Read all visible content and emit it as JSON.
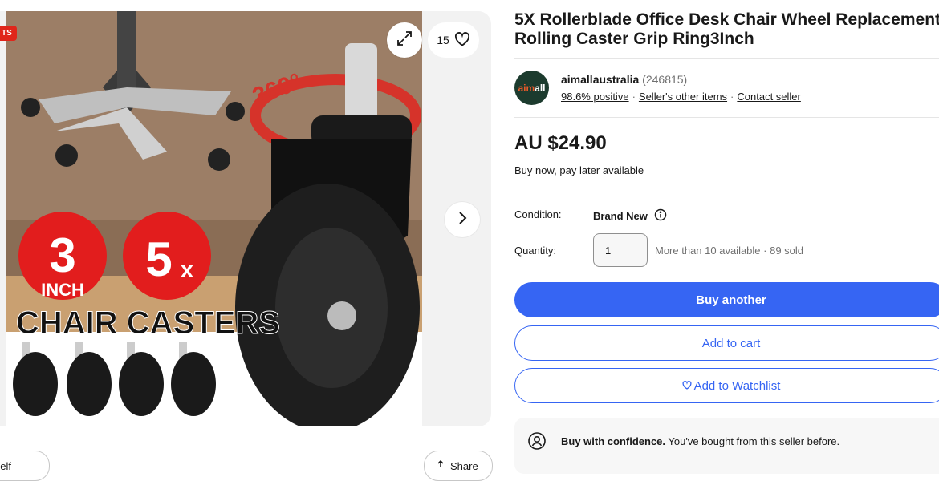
{
  "gallery": {
    "badge": "TS",
    "image_count": "15",
    "image_text": {
      "rotation": "360°",
      "size_number": "3",
      "size_unit": "INCH",
      "pack_number": "5",
      "pack_unit": "x",
      "caption": "CHAIR CASTERS"
    },
    "bottom_left_pill": "ourself",
    "share_label": "Share",
    "icons": [
      "expand-icon",
      "heart-icon",
      "chevron-right-icon",
      "share-icon"
    ]
  },
  "listing": {
    "title": "5X Rollerblade Office Desk Chair Wheel Replacement Rolling Caster Grip Ring3Inch",
    "seller": {
      "logo_text_a": "aim",
      "logo_text_b": "all",
      "name": "aimallaustralia",
      "feedback_count": "(246815)",
      "positive": "98.6% positive",
      "other_items": "Seller's other items",
      "contact": "Contact seller"
    },
    "price": "AU $24.90",
    "pay_later": "Buy now, pay later available",
    "condition_label": "Condition:",
    "condition_value": "Brand New",
    "quantity_label": "Quantity:",
    "quantity_value": "1",
    "availability": "More than 10 available · 89 sold",
    "buttons": {
      "buy": "Buy another",
      "cart": "Add to cart",
      "watch": "Add to Watchlist"
    },
    "confidence_bold": "Buy with confidence.",
    "confidence_text": "You've bought from this seller before."
  },
  "colors": {
    "accent": "#3665f3",
    "badge_red": "#e0261b",
    "text": "#191919",
    "muted": "#707070"
  }
}
